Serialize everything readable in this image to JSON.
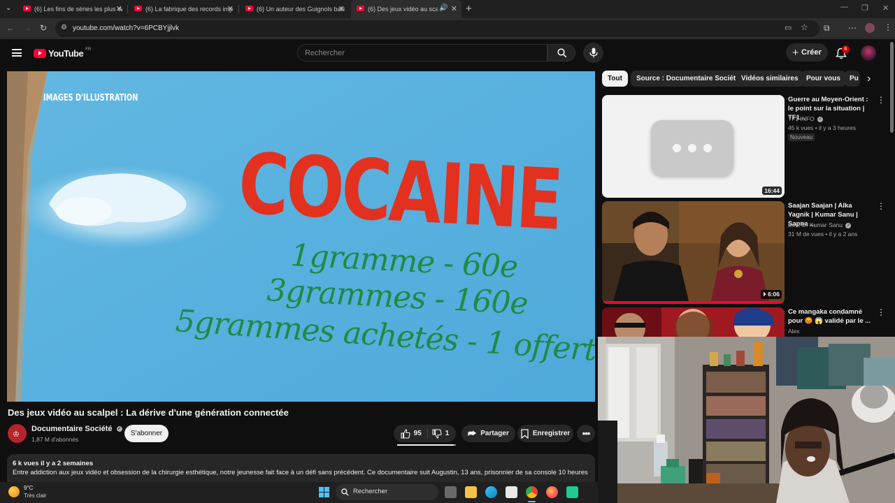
{
  "browser": {
    "tabs": [
      {
        "label": "(6) Les fins de séries les plus W"
      },
      {
        "label": "(6) La fabrique des records imp"
      },
      {
        "label": "(6) Un auteur des Guignols bala"
      },
      {
        "label": "(6) Des jeux vidéo au scalpe"
      }
    ],
    "url": "youtube.com/watch?v=6PCBYjjlvk"
  },
  "header": {
    "logo": "YouTube",
    "region": "FR",
    "search_placeholder": "Rechercher",
    "create_label": "Créer",
    "notifications_count": "6"
  },
  "player": {
    "watermark": "IMAGES D'ILLUSTRATION",
    "overlay_word": "COCAINE",
    "overlay_lines": [
      "1gramme - 60e",
      "3grammes - 160e",
      "5grammes achetés - 1 offert"
    ]
  },
  "video": {
    "title": "Des jeux vidéo au scalpel : La dérive d'une génération connectée",
    "channel": "Documentaire Société",
    "subscribers": "1,87 M d'abonnés",
    "subscribe_label": "S'abonner",
    "likes": "95",
    "dislikes": "1",
    "share_label": "Partager",
    "save_label": "Enregistrer",
    "views_date": "6 k vues  il y a 2 semaines",
    "description": "Entre addiction aux jeux vidéo et obsession de la chirurgie esthétique, notre jeunesse fait face à un défi sans précédent. Ce documentaire suit Augustin, 13 ans, prisonnier de sa console 10 heures par"
  },
  "filters": [
    "Tout",
    "Source : Documentaire Société",
    "Vidéos similaires",
    "Pour vous",
    "Pu"
  ],
  "recommendations": [
    {
      "title": "Guerre au Moyen-Orient : le point sur la situation | TF1...",
      "channel": "TF1 INFO",
      "meta": "45 k vues • il y a 3 heures",
      "badge": "Nouveau",
      "duration": "16:44"
    },
    {
      "title": "Saajan Saajan | Alka Yagnik | Kumar Sanu | Sapna ...",
      "channel": "Best Of Kumar Sanu",
      "meta": "31 M de vues • il y a 2 ans",
      "duration": "6:06"
    },
    {
      "title": "Ce mangaka condamné pour 😡 😱 validé par le ...",
      "channel": "Alex"
    }
  ],
  "taskbar": {
    "temperature": "9°C",
    "weather": "Très clair",
    "search_label": "Rechercher"
  },
  "colors": {
    "background": "#0f0f0f",
    "brand_red": "#ff0033",
    "video_sky": "#5db5e0",
    "overlay_red": "#e2311f",
    "overlay_green": "#1f8a45"
  }
}
